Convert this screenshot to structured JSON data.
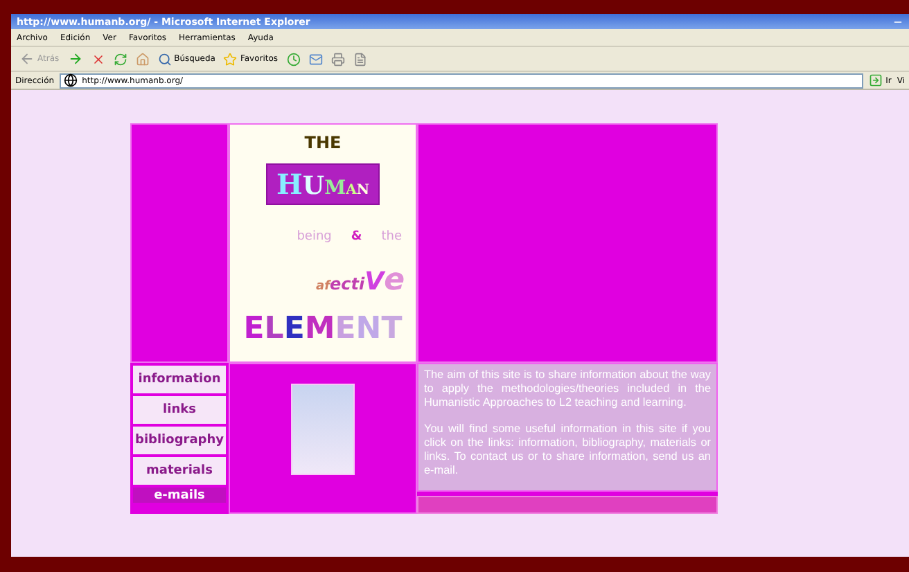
{
  "window": {
    "title": "http://www.humanb.org/ - Microsoft Internet Explorer"
  },
  "menu": [
    "Archivo",
    "Edición",
    "Ver",
    "Favoritos",
    "Herramientas",
    "Ayuda"
  ],
  "toolbar": {
    "back": "Atrás",
    "search": "Búsqueda",
    "favorites": "Favoritos"
  },
  "address": {
    "label": "Dirección",
    "value": "http://www.humanb.org/",
    "go": "Ir",
    "links": "Vi"
  },
  "site": {
    "logo": {
      "the_top": "THE",
      "human": "HUMAN",
      "being": "being",
      "amp": "&",
      "the": "the",
      "affective": "afectiVe",
      "element": "ELEMENT"
    },
    "nav": [
      {
        "label": "information",
        "kind": "tab"
      },
      {
        "label": "links",
        "kind": "tab"
      },
      {
        "label": "bibliography",
        "kind": "tab"
      },
      {
        "label": "materials",
        "kind": "tab"
      },
      {
        "label": "e-mails",
        "kind": "bar"
      }
    ],
    "paragraphs": [
      "The aim of this site is to share information about the way to apply the methodologies/theories included in the Humanistic Approaches to L2 teaching and learning.",
      "You will find some useful information in this site if you click on the links: information, bibliography, materials or links. To contact us or to share information, send us an e-mail."
    ]
  }
}
